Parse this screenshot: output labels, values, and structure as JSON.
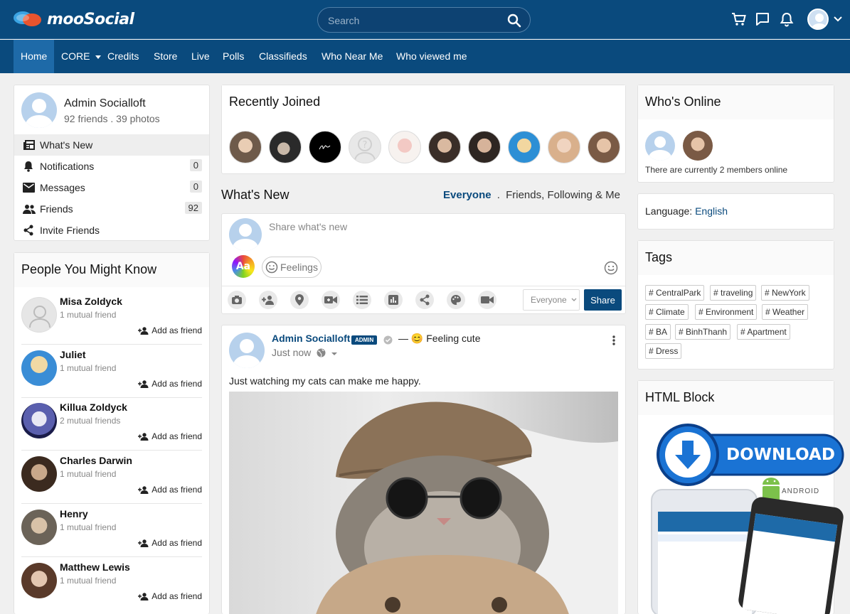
{
  "brand": {
    "name": "mooSocial",
    "accent": "#0a4a7d"
  },
  "search": {
    "placeholder": "Search"
  },
  "nav": {
    "items": [
      {
        "label": "Home",
        "active": true
      },
      {
        "label": "CORE",
        "dropdown": true
      },
      {
        "label": "Credits"
      },
      {
        "label": "Store"
      },
      {
        "label": "Live"
      },
      {
        "label": "Polls"
      },
      {
        "label": "Classifieds"
      },
      {
        "label": "Who Near Me"
      },
      {
        "label": "Who viewed me"
      }
    ]
  },
  "profile": {
    "name": "Admin Socialloft",
    "stats": "92 friends . 39 photos"
  },
  "menu": [
    {
      "label": "What's New",
      "icon": "newspaper-icon"
    },
    {
      "label": "Notifications",
      "icon": "bell-icon",
      "count": "0"
    },
    {
      "label": "Messages",
      "icon": "envelope-icon",
      "count": "0"
    },
    {
      "label": "Friends",
      "icon": "people-icon",
      "count": "92"
    },
    {
      "label": "Invite Friends",
      "icon": "share-icon"
    }
  ],
  "pymk": {
    "title": "People You Might Know",
    "add_label": "Add as friend",
    "people": [
      {
        "name": "Misa Zoldyck",
        "mutual": "1 mutual friend"
      },
      {
        "name": "Juliet",
        "mutual": "1 mutual friend"
      },
      {
        "name": "Killua Zoldyck",
        "mutual": "2 mutual friends"
      },
      {
        "name": "Charles Darwin",
        "mutual": "1 mutual friend"
      },
      {
        "name": "Henry",
        "mutual": "1 mutual friend"
      },
      {
        "name": "Matthew Lewis",
        "mutual": "1 mutual friend"
      }
    ]
  },
  "recently_joined": {
    "title": "Recently Joined"
  },
  "whatsnew": {
    "title": "What's New",
    "filter_active": "Everyone",
    "filter_sep": ".",
    "filter_other": "Friends, Following & Me"
  },
  "composer": {
    "placeholder": "Share what's new",
    "feelings_label": "Feelings",
    "privacy": "Everyone",
    "share_label": "Share"
  },
  "post": {
    "author": "Admin Socialloft",
    "badge": "ADMIN",
    "feeling": "— 😊 Feeling cute",
    "time": "Just now",
    "text": "Just watching my cats can make me happy."
  },
  "online": {
    "title": "Who's Online",
    "text": "There are currently 2 members online"
  },
  "language": {
    "label": "Language:",
    "value": "English"
  },
  "tags": {
    "title": "Tags",
    "items": [
      "# CentralPark",
      "# traveling",
      "# NewYork",
      "# Climate",
      "# Environment",
      "# Weather",
      "# BA",
      "# BinhThanh",
      "# Apartment",
      "# Dress"
    ]
  },
  "html_block": {
    "title": "HTML Block",
    "download": "DOWNLOAD",
    "android": "ANDROID"
  }
}
